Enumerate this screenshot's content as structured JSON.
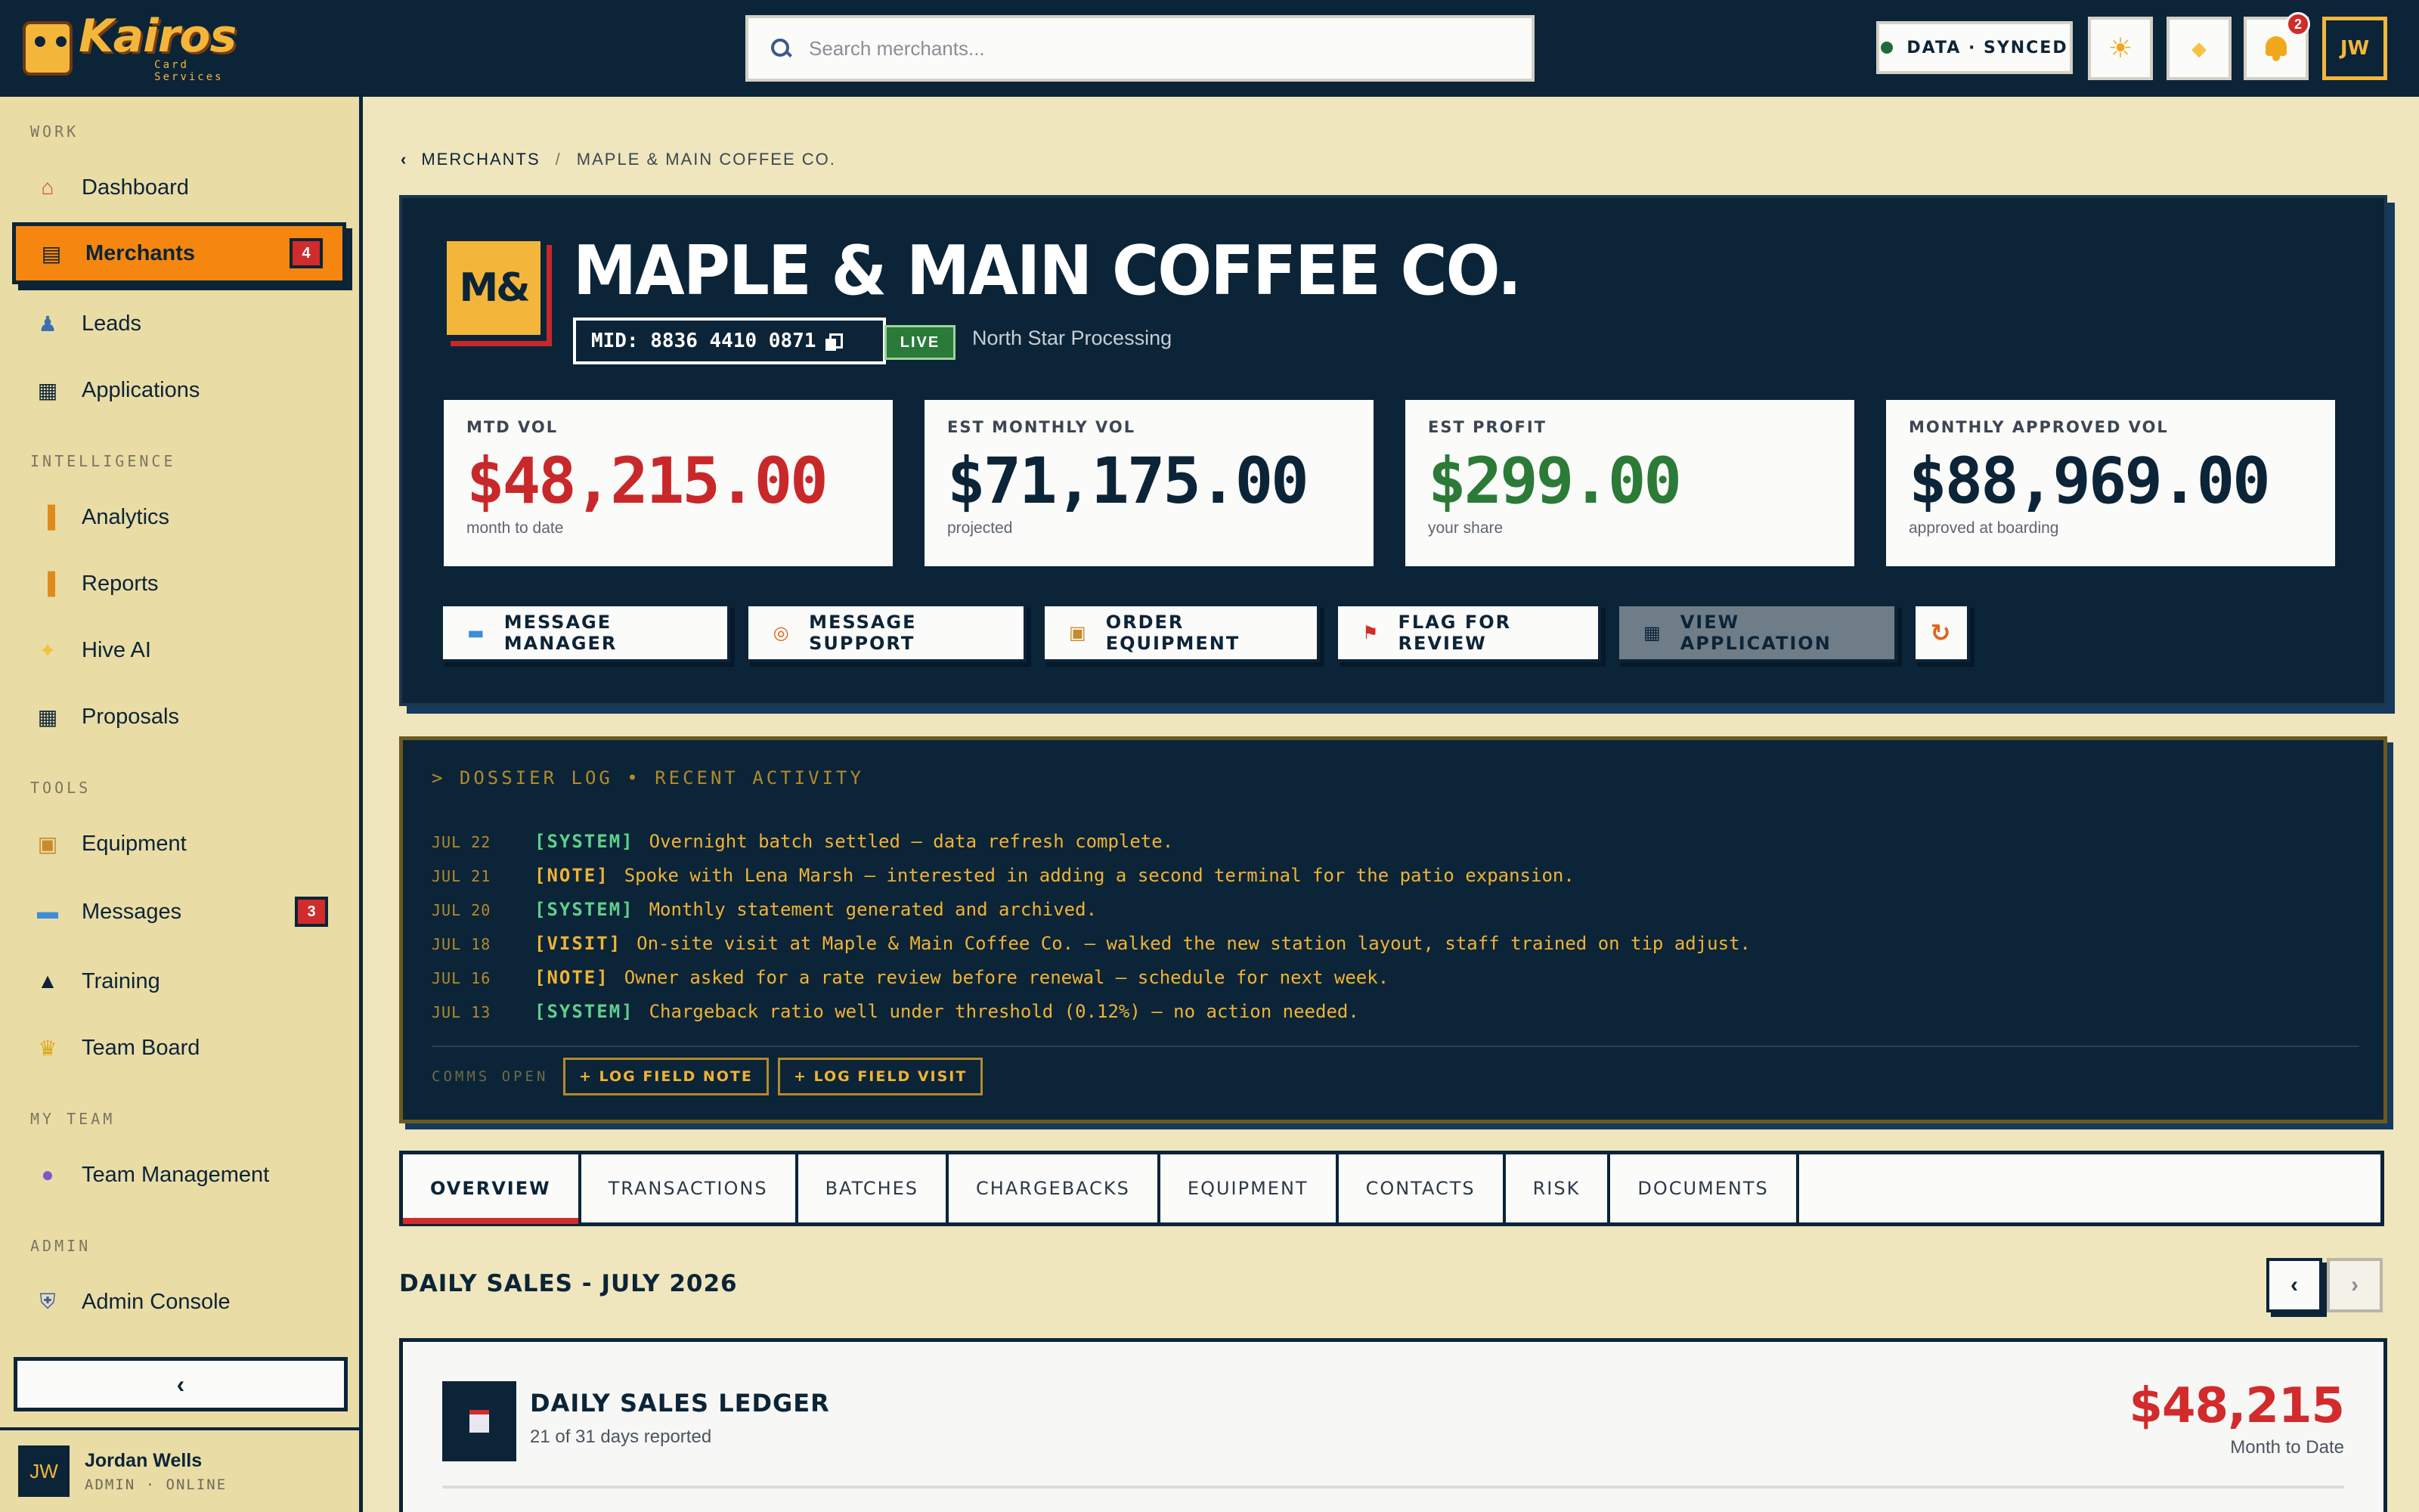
{
  "app": {
    "name": "Kairos",
    "tagline": "Card Services"
  },
  "search": {
    "placeholder": "Search merchants..."
  },
  "topbar": {
    "sync_status": "DATA · SYNCED",
    "notification_count": "2",
    "user_initials": "JW"
  },
  "sidebar": {
    "sections": {
      "work": "WORK",
      "intelligence": "INTELLIGENCE",
      "tools": "TOOLS",
      "my_team": "MY TEAM",
      "admin": "ADMIN"
    },
    "items": [
      {
        "label": "Dashboard",
        "icon": "home-icon"
      },
      {
        "label": "Merchants",
        "icon": "storefront-icon",
        "badge": "4",
        "active": true
      },
      {
        "label": "Leads",
        "icon": "person-icon"
      },
      {
        "label": "Applications",
        "icon": "document-icon"
      },
      {
        "label": "Analytics",
        "icon": "bar-chart-icon"
      },
      {
        "label": "Reports",
        "icon": "bar-chart-icon"
      },
      {
        "label": "Hive AI",
        "icon": "sparkle-icon"
      },
      {
        "label": "Proposals",
        "icon": "document-icon"
      },
      {
        "label": "Equipment",
        "icon": "box-icon"
      },
      {
        "label": "Messages",
        "icon": "chat-icon",
        "badge": "3"
      },
      {
        "label": "Training",
        "icon": "graduation-cap-icon"
      },
      {
        "label": "Team Board",
        "icon": "trophy-icon"
      },
      {
        "label": "Team Management",
        "icon": "user-circle-icon"
      },
      {
        "label": "Admin Console",
        "icon": "shield-icon"
      }
    ],
    "collapse_glyph": "‹",
    "user": {
      "initials": "JW",
      "name": "Jordan Wells",
      "role": "ADMIN · ONLINE"
    }
  },
  "breadcrumb": {
    "back": "MERCHANTS",
    "separator": "/",
    "current": "MAPLE & MAIN COFFEE CO."
  },
  "merchant": {
    "monogram": "M&",
    "name": "MAPLE & MAIN COFFEE CO.",
    "mid": "MID: 8836 4410 0871",
    "status": "LIVE",
    "processor": "North Star Processing"
  },
  "kpis": [
    {
      "label": "MTD VOL",
      "value": "$48,215.00",
      "sub": "month to date",
      "color": "#c8282a"
    },
    {
      "label": "EST MONTHLY VOL",
      "value": "$71,175.00",
      "sub": "projected",
      "color": "#0b2438"
    },
    {
      "label": "EST PROFIT",
      "value": "$299.00",
      "sub": "your share",
      "color": "#2b7a38"
    },
    {
      "label": "MONTHLY APPROVED VOL",
      "value": "$88,969.00",
      "sub": "approved at boarding",
      "color": "#0b2438"
    }
  ],
  "actions": {
    "message_manager": "MESSAGE MANAGER",
    "message_support": "MESSAGE SUPPORT",
    "order_equipment": "ORDER EQUIPMENT",
    "flag_for_review": "FLAG FOR REVIEW",
    "view_application": "VIEW APPLICATION"
  },
  "dossier": {
    "header": "> DOSSIER LOG • RECENT ACTIVITY",
    "entries": [
      {
        "date": "JUL 22",
        "tag": "[SYSTEM]",
        "text": "Overnight batch settled — data refresh complete."
      },
      {
        "date": "JUL 21",
        "tag": "[NOTE]",
        "text": "Spoke with Lena Marsh — interested in adding a second terminal for the patio expansion."
      },
      {
        "date": "JUL 20",
        "tag": "[SYSTEM]",
        "text": "Monthly statement generated and archived."
      },
      {
        "date": "JUL 18",
        "tag": "[VISIT]",
        "text": "On-site visit at Maple & Main Coffee Co. — walked the new station layout, staff trained on tip adjust."
      },
      {
        "date": "JUL 16",
        "tag": "[NOTE]",
        "text": "Owner asked for a rate review before renewal — schedule for next week."
      },
      {
        "date": "JUL 13",
        "tag": "[SYSTEM]",
        "text": "Chargeback ratio well under threshold (0.12%) — no action needed."
      }
    ],
    "comms": "COMMS OPEN",
    "log_note": "+ LOG FIELD NOTE",
    "log_visit": "+ LOG FIELD VISIT"
  },
  "tabs": [
    "OVERVIEW",
    "TRANSACTIONS",
    "BATCHES",
    "CHARGEBACKS",
    "EQUIPMENT",
    "CONTACTS",
    "RISK",
    "DOCUMENTS"
  ],
  "daily_sales": {
    "title": "DAILY SALES - JULY 2026",
    "prev": "‹",
    "next": "›",
    "ledger_title": "DAILY SALES LEDGER",
    "ledger_sub": "21 of 31 days reported",
    "total": "$48,215",
    "total_label": "Month to Date"
  }
}
